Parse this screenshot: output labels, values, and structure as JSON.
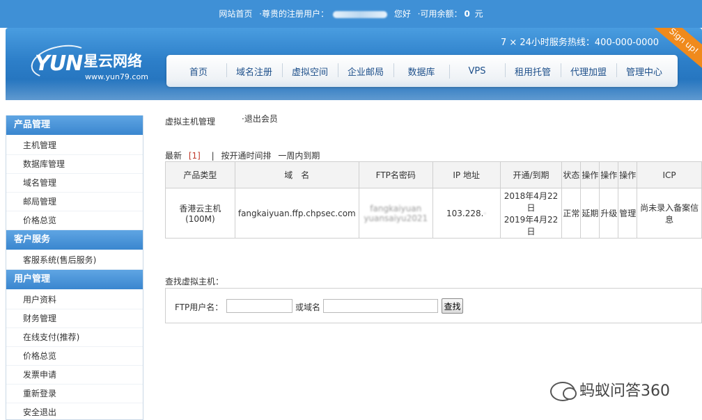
{
  "topbar": {
    "home": "网站首页",
    "greeting_prefix": "·尊贵的注册用户：",
    "greeting_suffix": "您好",
    "balance_label": "·可用余额：",
    "balance_value": "0",
    "balance_unit": "元"
  },
  "header": {
    "logo_yun": "YUN",
    "logo_cn": "星云网络",
    "logo_url": "www.yun79.com",
    "hotline": "7 × 24小时服务热线：400-000-0000",
    "signup": "Sign up!",
    "nav": [
      "首页",
      "域名注册",
      "虚拟空间",
      "企业邮局",
      "数据库",
      "VPS",
      "租用托管",
      "代理加盟",
      "管理中心"
    ]
  },
  "sidebar": {
    "sections": [
      {
        "title": "产品管理",
        "items": [
          "主机管理",
          "数据库管理",
          "域名管理",
          "邮局管理",
          "价格总览"
        ]
      },
      {
        "title": "客户服务",
        "items": [
          "客服系统(售后服务)"
        ]
      },
      {
        "title": "用户管理",
        "items": [
          "用户资料",
          "财务管理",
          "在线支付(推荐)",
          "价格总览",
          "发票申请",
          "重新登录",
          "安全退出"
        ]
      }
    ]
  },
  "main": {
    "breadcrumb": "虚拟主机管理",
    "logout": "·退出会员",
    "filter": {
      "latest": "最新",
      "count": "[1]",
      "sep": "|",
      "by_open_time": "按开通时间排",
      "expire_week": "一周内到期"
    },
    "table": {
      "headers": [
        "产品类型",
        "域　名",
        "FTP名密码",
        "IP 地址",
        "开通/到期",
        "状态",
        "操作",
        "操作",
        "操作",
        "ICP"
      ],
      "rows": [
        {
          "type": "香港云主机(100M)",
          "domain": "fangkaiyuan.ffp.chpsec.com",
          "ftp_user": "fangkaiyuan",
          "ftp_pass": "yuansaiyu2021",
          "ip": "103.228.",
          "open": "2018年4月22日",
          "expire": "2019年4月22日",
          "status": "正常",
          "op1": "延期",
          "op2": "升级",
          "op3": "管理",
          "icp": "尚未录入备案信息"
        }
      ]
    },
    "search": {
      "title": "查找虚拟主机：",
      "ftp_label": "FTP用户名：",
      "or_domain_label": "或域名",
      "ftp_value": "",
      "domain_value": "",
      "button": "查找"
    }
  },
  "watermark": "蚂蚁问答360"
}
